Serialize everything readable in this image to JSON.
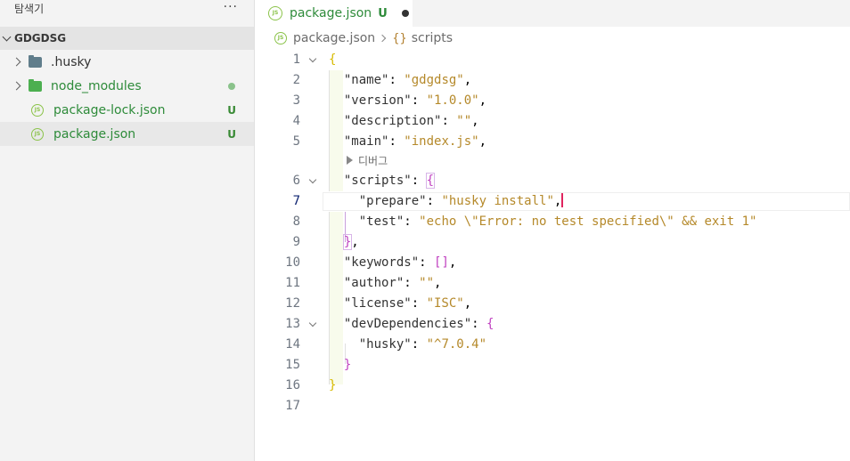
{
  "sidebar": {
    "title": "탐색기",
    "more": "···",
    "section": "GDGDSG",
    "items": [
      {
        "label": ".husky",
        "kind": "folder",
        "icon": "folder-icon-grey"
      },
      {
        "label": "node_modules",
        "kind": "folder",
        "icon": "folder-icon-green"
      },
      {
        "label": "package-lock.json",
        "kind": "file",
        "icon": "js-icon",
        "status": "U"
      },
      {
        "label": "package.json",
        "kind": "file",
        "icon": "js-icon",
        "status": "U"
      }
    ]
  },
  "tab": {
    "label": "package.json",
    "status": "U",
    "icon": "js-icon"
  },
  "breadcrumb": {
    "file": "package.json",
    "braces": "{}",
    "symbol": "scripts"
  },
  "editor": {
    "line_numbers": [
      "1",
      "2",
      "3",
      "4",
      "5",
      "6",
      "7",
      "8",
      "9",
      "10",
      "11",
      "12",
      "13",
      "14",
      "15",
      "16",
      "17"
    ],
    "active_line": "7",
    "codelens": "디버그",
    "lines": {
      "l1": "{",
      "l2_key": "\"name\"",
      "l2_val": "\"gdgdsg\"",
      "l3_key": "\"version\"",
      "l3_val": "\"1.0.0\"",
      "l4_key": "\"description\"",
      "l4_val": "\"\"",
      "l5_key": "\"main\"",
      "l5_val": "\"index.js\"",
      "l6_key": "\"scripts\"",
      "l6_open": "{",
      "l7_key": "\"prepare\"",
      "l7_val": "\"husky install\"",
      "l8_key": "\"test\"",
      "l8_val": "\"echo \\\"Error: no test specified\\\" && exit 1\"",
      "l9_close": "}",
      "l10_key": "\"keywords\"",
      "l10_val": "[]",
      "l11_key": "\"author\"",
      "l11_val": "\"\"",
      "l12_key": "\"license\"",
      "l12_val": "\"ISC\"",
      "l13_key": "\"devDependencies\"",
      "l13_open": "{",
      "l14_key": "\"husky\"",
      "l14_val": "\"^7.0.4\"",
      "l15_close": "}",
      "l16": "}"
    }
  }
}
